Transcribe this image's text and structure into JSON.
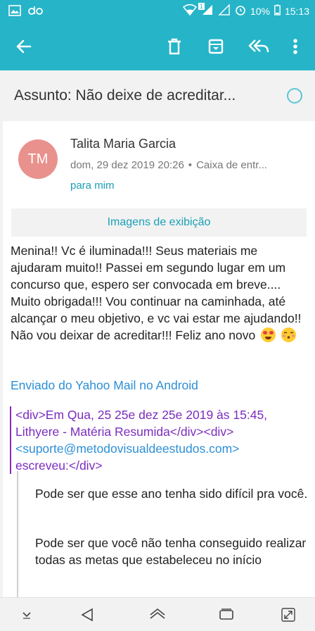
{
  "status_bar": {
    "battery": "10%",
    "time": "15:13",
    "sim_badge": "1"
  },
  "app_bar": {
    "icons": [
      "back-arrow-icon",
      "trash-icon",
      "archive-icon",
      "reply-all-icon",
      "more-vert-icon"
    ]
  },
  "email": {
    "subject": "Assunto: Não deixe de acreditar...",
    "sender_initials": "TM",
    "sender_name": "Talita Maria Garcia",
    "date": "dom, 29 dez 2019 20:26",
    "folder": "Caixa de entr...",
    "recipient": "para mim",
    "show_images": "Imagens de exibição",
    "body": "Menina!! Vc é iluminada!!! Seus materiais me ajudaram muito!! Passei em segundo lugar em um concurso que, espero ser convocada em breve.... Muito obrigada!!! Vou continuar na caminhada, até alcançar o meu objetivo, e vc vai estar me ajudando!! Não vou deixar de acreditar!!! Feliz ano novo",
    "signature": "Enviado do Yahoo Mail no Android",
    "quote_header_1": "<div>Em Qua, 25 25e dez 25e 2019 às 15:45, Lithyere - Matéria Resumida</div><div>",
    "quote_email": "<suporte@metodovisualdeestudos.com>",
    "quote_header_2": "escreveu:</div>",
    "quoted_para_1": "Pode ser que esse ano tenha sido difícil pra você.",
    "quoted_para_2": "Pode ser que você não tenha conseguido realizar todas as metas que estabeleceu no início"
  },
  "colors": {
    "app_bar": "#26b4c8",
    "link": "#2d8fd6",
    "accent": "#1aa0b6",
    "quote": "#7b2cbf",
    "avatar": "#e9918d"
  }
}
